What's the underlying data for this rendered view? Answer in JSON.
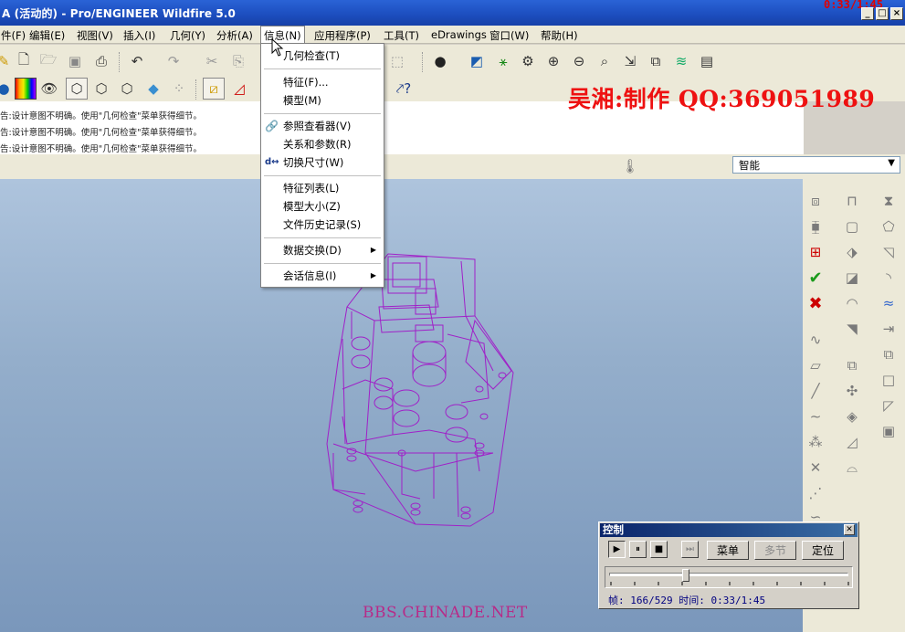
{
  "window": {
    "title": "A (活动的) - Pro/ENGINEER Wildfire 5.0",
    "timer": "0:33/1:45"
  },
  "menubar": {
    "items": [
      "件(F)",
      "编辑(E)",
      "视图(V)",
      "插入(I)",
      "几何(Y)",
      "分析(A)",
      "信息(N)",
      "应用程序(P)",
      "工具(T)",
      "eDrawings",
      "窗口(W)",
      "帮助(H)"
    ]
  },
  "messages": [
    "告:设计意图不明确。使用\"几何检查\"菜单获得细节。",
    "告:设计意图不明确。使用\"几何检查\"菜单获得细节。",
    "告:设计意图不明确。使用\"几何检查\"菜单获得细节。"
  ],
  "filter": {
    "selected": "智能"
  },
  "info_menu": {
    "items": [
      {
        "label": "几何检查(T)",
        "icon": "",
        "submenu": false
      },
      {
        "label": "特征(F)...",
        "icon": "",
        "submenu": false
      },
      {
        "label": "模型(M)",
        "icon": "",
        "submenu": false
      },
      {
        "label": "参照查看器(V)",
        "icon": "reference-viewer-icon",
        "submenu": false
      },
      {
        "label": "关系和参数(R)",
        "icon": "",
        "submenu": false
      },
      {
        "label": "切换尺寸(W)",
        "icon": "switch-dimension-icon",
        "submenu": false
      },
      {
        "label": "特征列表(L)",
        "icon": "",
        "submenu": false
      },
      {
        "label": "模型大小(Z)",
        "icon": "",
        "submenu": false
      },
      {
        "label": "文件历史记录(S)",
        "icon": "",
        "submenu": false
      },
      {
        "label": "数据交换(D)",
        "icon": "",
        "submenu": true
      },
      {
        "label": "会话信息(I)",
        "icon": "",
        "submenu": true
      }
    ]
  },
  "watermark": {
    "author": "吴湘:制作  QQ:369051989",
    "site": "BBS.CHINADE.NET"
  },
  "control": {
    "title": "控制",
    "menu_label": "菜单",
    "section_label": "多节",
    "locate_label": "定位",
    "status": "帧: 166/529 时间: 0:33/1:45",
    "progress": 0.314
  },
  "colors": {
    "title_blue": "#1d4fc0",
    "wireframe": "#a020c8",
    "watermark_red": "#ee1111",
    "viewport_top": "#aec4dd",
    "viewport_bottom": "#7a97bb"
  }
}
